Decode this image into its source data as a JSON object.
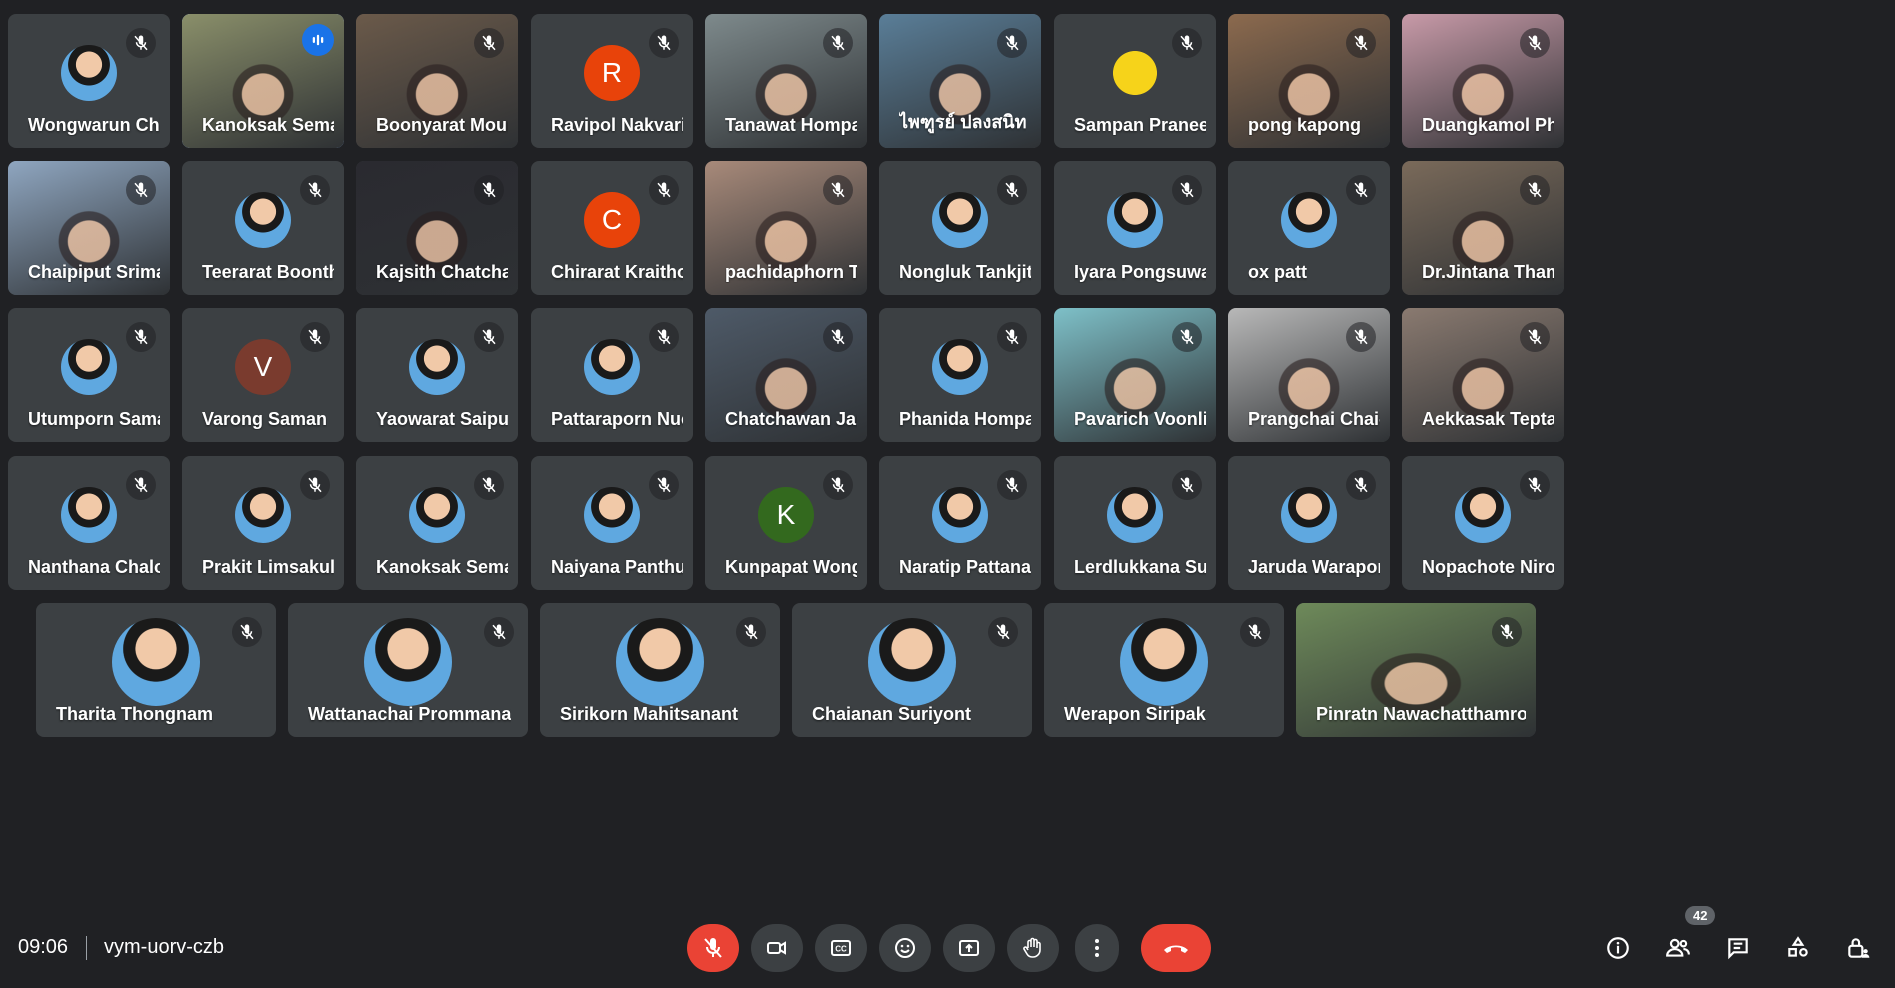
{
  "meeting": {
    "time": "09:06",
    "code": "vym-uorv-czb",
    "participant_count": "42"
  },
  "colors": {
    "background": "#202124",
    "tile": "#3c4043",
    "speaking_outline": "#8ab4f8",
    "end_call": "#ea4335",
    "avatar_R": "#e8430a",
    "avatar_C": "#e8430a",
    "avatar_V": "#7a3b2e",
    "avatar_K": "#33691e"
  },
  "participants": [
    {
      "name": "Wongwarun Chir...",
      "type": "photo"
    },
    {
      "name": "Kanoksak Semake",
      "type": "video",
      "speaking": true,
      "bg": "#8a8f6a"
    },
    {
      "name": "Boonyarat Moun...",
      "type": "video",
      "bg": "#6b5a4a"
    },
    {
      "name": "Ravipol Nakvari",
      "type": "letter",
      "letter": "R",
      "color": "#e8430a"
    },
    {
      "name": "Tanawat Hompan",
      "type": "video",
      "bg": "#7e8a8c"
    },
    {
      "name": "ไพฑูรย์ ปลงสนิท",
      "type": "video",
      "bg": "#5a7e98"
    },
    {
      "name": "Sampan Pranee...",
      "type": "photo-yellow"
    },
    {
      "name": "pong kapong",
      "type": "video",
      "bg": "#8c6a4e"
    },
    {
      "name": "Duangkamol Pho...",
      "type": "video",
      "bg": "#c89aa8"
    },
    {
      "name": "Chaipiput Srima...",
      "type": "video",
      "bg": "#8fa6c0"
    },
    {
      "name": "Teerarat Boonth...",
      "type": "photo"
    },
    {
      "name": "Kajsith Chatchal...",
      "type": "video",
      "bg": "#2a2a30"
    },
    {
      "name": "Chirarat Kraitho...",
      "type": "letter",
      "letter": "C",
      "color": "#e8430a"
    },
    {
      "name": "pachidaphorn Th...",
      "type": "video",
      "bg": "#a88a7a"
    },
    {
      "name": "Nongluk Tankjitt...",
      "type": "photo"
    },
    {
      "name": "Iyara Pongsuwan",
      "type": "photo"
    },
    {
      "name": "ox patt",
      "type": "photo"
    },
    {
      "name": "Dr.Jintana Tham...",
      "type": "video",
      "bg": "#7a6a5a"
    },
    {
      "name": "Utumporn Saman",
      "type": "photo"
    },
    {
      "name": "Varong Saman",
      "type": "letter",
      "letter": "V",
      "color": "#7a3b2e"
    },
    {
      "name": "Yaowarat Saipue",
      "type": "photo"
    },
    {
      "name": "Pattaraporn Nuc...",
      "type": "photo"
    },
    {
      "name": "Chatchawan Jan...",
      "type": "video",
      "bg": "#4e5a68"
    },
    {
      "name": "Phanida Hompan",
      "type": "photo"
    },
    {
      "name": "Pavarich Voonliam",
      "type": "video",
      "bg": "#7ec0c8"
    },
    {
      "name": "Prangchai Chai-Im",
      "type": "video",
      "bg": "#b8b8b8"
    },
    {
      "name": "Aekkasak Teptan...",
      "type": "video",
      "bg": "#8a7a70"
    },
    {
      "name": "Nanthana Chaloe...",
      "type": "photo"
    },
    {
      "name": "Prakit Limsakul",
      "type": "photo"
    },
    {
      "name": "Kanoksak Semake",
      "type": "photo"
    },
    {
      "name": "Naiyana Panthup...",
      "type": "photo"
    },
    {
      "name": "Kunpapat Wongc...",
      "type": "letter",
      "letter": "K",
      "color": "#33691e"
    },
    {
      "name": "Naratip Pattanad...",
      "type": "photo"
    },
    {
      "name": "Lerdlukkana Suw...",
      "type": "photo"
    },
    {
      "name": "Jaruda Warapor...",
      "type": "photo"
    },
    {
      "name": "Nopachote Niroj...",
      "type": "photo"
    },
    {
      "name": "Tharita Thongnam",
      "type": "photo-lg"
    },
    {
      "name": "Wattanachai Prommana",
      "type": "photo-lg"
    },
    {
      "name": "Sirikorn Mahitsanant",
      "type": "photo-lg"
    },
    {
      "name": "Chaianan Suriyont",
      "type": "photo-lg"
    },
    {
      "name": "Werapon Siripak",
      "type": "photo-lg"
    },
    {
      "name": "Pinratn Nawachatthamrong",
      "type": "video",
      "bg": "#6e8a5a"
    }
  ],
  "controls": [
    {
      "name": "mic-off-button",
      "icon": "mic-off-icon"
    },
    {
      "name": "camera-button",
      "icon": "camera-icon"
    },
    {
      "name": "captions-button",
      "icon": "captions-icon"
    },
    {
      "name": "emoji-button",
      "icon": "emoji-icon"
    },
    {
      "name": "present-button",
      "icon": "present-icon"
    },
    {
      "name": "raise-hand-button",
      "icon": "hand-icon"
    },
    {
      "name": "more-options-button",
      "icon": "more-vert-icon"
    },
    {
      "name": "leave-call-button",
      "icon": "phone-hangup-icon"
    }
  ],
  "right_controls": [
    {
      "name": "meeting-info-button",
      "icon": "info-icon"
    },
    {
      "name": "people-button",
      "icon": "people-icon"
    },
    {
      "name": "chat-button",
      "icon": "chat-icon"
    },
    {
      "name": "activities-button",
      "icon": "activities-icon"
    },
    {
      "name": "host-controls-button",
      "icon": "lock-person-icon"
    }
  ]
}
